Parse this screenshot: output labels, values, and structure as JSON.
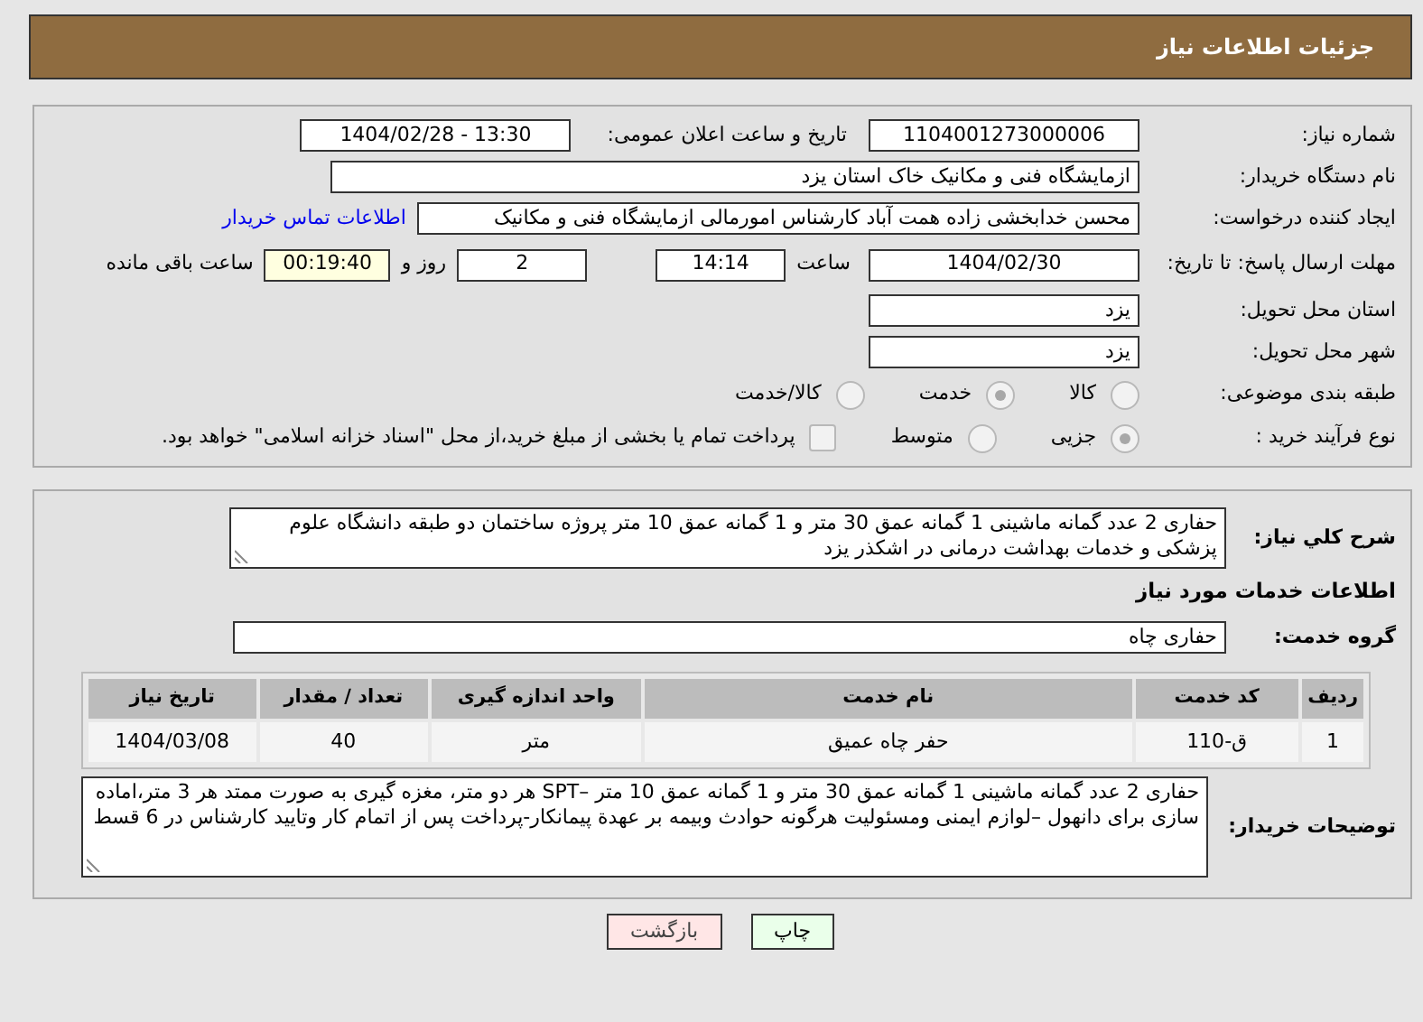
{
  "header": {
    "title": "جزئیات اطلاعات نیاز"
  },
  "need_number": {
    "label": "شماره نیاز:",
    "value": "1104001273000006"
  },
  "announce": {
    "label": "تاریخ و ساعت اعلان عمومی:",
    "value": "1404/02/28 - 13:30"
  },
  "buyer_org": {
    "label": "نام دستگاه خریدار:",
    "value": "ازمایشگاه فنی و مکانیک خاک استان یزد"
  },
  "creator": {
    "label": "ایجاد کننده درخواست:",
    "value": "محسن خدابخشی زاده همت آباد کارشناس امورمالی ازمایشگاه فنی و مکانیک",
    "link": "اطلاعات تماس خریدار"
  },
  "deadline": {
    "label": "مهلت ارسال پاسخ: تا تاریخ:",
    "date": "1404/02/30",
    "time_label": "ساعت",
    "time": "14:14",
    "days": "2",
    "days_label": "روز و",
    "remaining": "00:19:40",
    "remaining_label": "ساعت باقی مانده"
  },
  "province": {
    "label": "استان محل تحویل:",
    "value": "یزد"
  },
  "city": {
    "label": "شهر محل تحویل:",
    "value": "یزد"
  },
  "category": {
    "label": "طبقه بندی موضوعی:",
    "options": [
      {
        "label": "کالا",
        "selected": false
      },
      {
        "label": "خدمت",
        "selected": true
      },
      {
        "label": "کالا/خدمت",
        "selected": false
      }
    ]
  },
  "process": {
    "label": "نوع فرآیند خرید :",
    "options": [
      {
        "label": "جزیی",
        "selected": true
      },
      {
        "label": "متوسط",
        "selected": false
      }
    ],
    "payment": {
      "checked": false,
      "label": "پرداخت تمام یا بخشی از مبلغ خرید،از محل \"اسناد خزانه اسلامی\" خواهد بود."
    }
  },
  "summary": {
    "label": "شرح کلي نياز:",
    "value": "حفاری 2 عدد گمانه ماشینی 1 گمانه عمق 30 متر و 1 گمانه عمق 10 متر پروژه ساختمان دو طبقه دانشگاه علوم پزشکی و خدمات بهداشت درمانی در اشکذر یزد"
  },
  "services_heading": "اطلاعات خدمات مورد نیاز",
  "service_group": {
    "label": "گروه خدمت:",
    "value": "حفاری چاه"
  },
  "table": {
    "columns": [
      "ردیف",
      "کد خدمت",
      "نام خدمت",
      "واحد اندازه گیری",
      "تعداد / مقدار",
      "تاریخ نیاز"
    ],
    "rows": [
      [
        "1",
        "ق-110",
        "حفر چاه عمیق",
        "متر",
        "40",
        "1404/03/08"
      ]
    ]
  },
  "buyer_notes": {
    "label": "توضیحات خریدار:",
    "value": "حفاری 2 عدد گمانه ماشینی 1 گمانه عمق 30 متر و 1 گمانه عمق 10 متر –SPT هر دو متر، مغزه گیری به صورت ممتد هر 3 متر،اماده سازی برای دانهول –لوازم ایمنی ومسئولیت هرگونه حوادث وبیمه بر عهدة پیمانکار-پرداخت پس از اتمام کار وتایید کارشناس در 6 قسط"
  },
  "buttons": [
    {
      "label": "چاپ",
      "kind": "print"
    },
    {
      "label": "بازگشت",
      "kind": "back"
    }
  ]
}
